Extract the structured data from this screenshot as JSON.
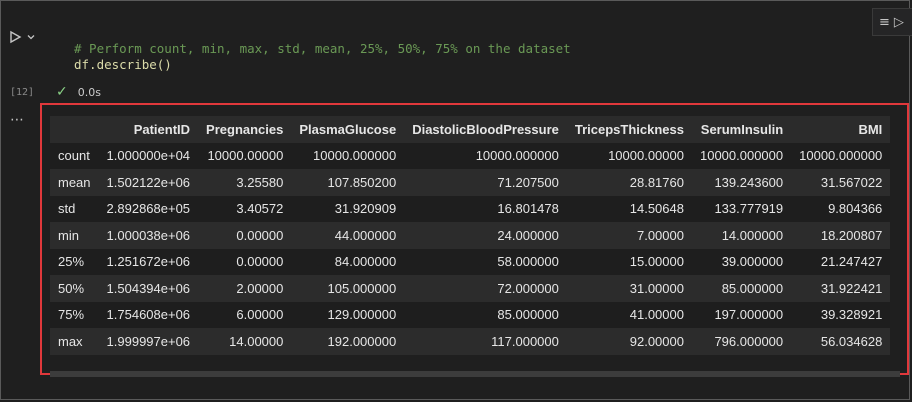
{
  "cell": {
    "execution_count": "[12]",
    "code_comment": "# Perform count, min, max, std, mean, 25%, 50%, 75% on the dataset",
    "code_line": "df.describe()",
    "status_time": "0.0s"
  },
  "colors": {
    "highlight_border": "#e0383b",
    "comment": "#6a9955",
    "function": "#dcdcaa",
    "success": "#89d185"
  },
  "icons": {
    "run": "play-icon",
    "run_dropdown": "chevron-down-icon",
    "toolbar_1": "split-cell-icon",
    "toolbar_2": "more-panel-icon",
    "status": "check-icon",
    "output_menu": "ellipsis-icon"
  },
  "table": {
    "columns": [
      "",
      "PatientID",
      "Pregnancies",
      "PlasmaGlucose",
      "DiastolicBloodPressure",
      "TricepsThickness",
      "SerumInsulin",
      "BMI"
    ],
    "rows": [
      {
        "label": "count",
        "values": [
          "1.000000e+04",
          "10000.00000",
          "10000.000000",
          "10000.000000",
          "10000.00000",
          "10000.000000",
          "10000.000000"
        ]
      },
      {
        "label": "mean",
        "values": [
          "1.502122e+06",
          "3.25580",
          "107.850200",
          "71.207500",
          "28.81760",
          "139.243600",
          "31.567022"
        ]
      },
      {
        "label": "std",
        "values": [
          "2.892868e+05",
          "3.40572",
          "31.920909",
          "16.801478",
          "14.50648",
          "133.777919",
          "9.804366"
        ]
      },
      {
        "label": "min",
        "values": [
          "1.000038e+06",
          "0.00000",
          "44.000000",
          "24.000000",
          "7.00000",
          "14.000000",
          "18.200807"
        ]
      },
      {
        "label": "25%",
        "values": [
          "1.251672e+06",
          "0.00000",
          "84.000000",
          "58.000000",
          "15.00000",
          "39.000000",
          "21.247427"
        ]
      },
      {
        "label": "50%",
        "values": [
          "1.504394e+06",
          "2.00000",
          "105.000000",
          "72.000000",
          "31.00000",
          "85.000000",
          "31.922421"
        ]
      },
      {
        "label": "75%",
        "values": [
          "1.754608e+06",
          "6.00000",
          "129.000000",
          "85.000000",
          "41.00000",
          "197.000000",
          "39.328921"
        ]
      },
      {
        "label": "max",
        "values": [
          "1.999997e+06",
          "14.00000",
          "192.000000",
          "117.000000",
          "92.00000",
          "796.000000",
          "56.034628"
        ]
      }
    ]
  }
}
